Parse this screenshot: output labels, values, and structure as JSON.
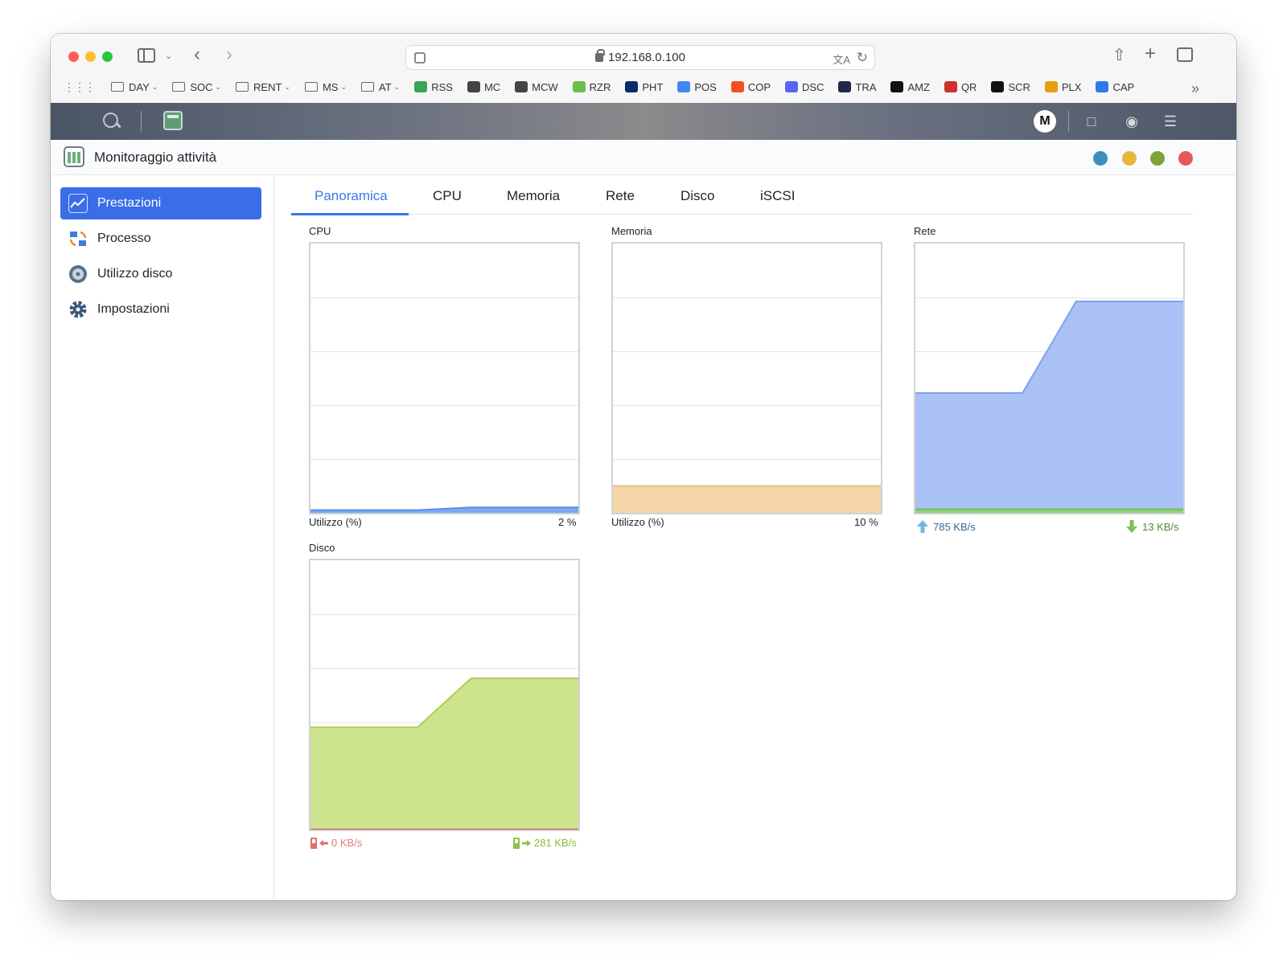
{
  "browser": {
    "url": "192.168.0.100",
    "bookmarks": [
      {
        "label": "DAY",
        "folder": true
      },
      {
        "label": "SOC",
        "folder": true
      },
      {
        "label": "RENT",
        "folder": true
      },
      {
        "label": "MS",
        "folder": true
      },
      {
        "label": "AT",
        "folder": true
      },
      {
        "label": "RSS",
        "color": "#3aa35a"
      },
      {
        "label": "MC",
        "color": "#444444"
      },
      {
        "label": "MCW",
        "color": "#444444"
      },
      {
        "label": "RZR",
        "color": "#6bbf4a"
      },
      {
        "label": "PHT",
        "color": "#0b2a6b"
      },
      {
        "label": "POS",
        "color": "#4285f4"
      },
      {
        "label": "COP",
        "color": "#f25022"
      },
      {
        "label": "DSC",
        "color": "#5865f2"
      },
      {
        "label": "TRA",
        "color": "#1f2a44"
      },
      {
        "label": "AMZ",
        "color": "#111111"
      },
      {
        "label": "QR",
        "color": "#d0312d"
      },
      {
        "label": "SCR",
        "color": "#111111"
      },
      {
        "label": "PLX",
        "color": "#e5a00d"
      },
      {
        "label": "CAP",
        "color": "#2f7bea"
      }
    ]
  },
  "dsm": {
    "avatar_letter": "M"
  },
  "app": {
    "title": "Monitoraggio attività"
  },
  "sidebar": {
    "items": [
      {
        "label": "Prestazioni",
        "active": true
      },
      {
        "label": "Processo",
        "active": false
      },
      {
        "label": "Utilizzo disco",
        "active": false
      },
      {
        "label": "Impostazioni",
        "active": false
      }
    ]
  },
  "tabs": [
    "Panoramica",
    "CPU",
    "Memoria",
    "Rete",
    "Disco",
    "iSCSI"
  ],
  "active_tab": "Panoramica",
  "panels": {
    "cpu": {
      "title": "CPU",
      "foot_label": "Utilizzo (%)",
      "foot_value": "2 %"
    },
    "memory": {
      "title": "Memoria",
      "foot_label": "Utilizzo (%)",
      "foot_value": "10 %"
    },
    "network": {
      "title": "Rete",
      "upload": "785 KB/s",
      "download": "13 KB/s"
    },
    "disk": {
      "title": "Disco",
      "read": "0 KB/s",
      "write": "281 KB/s"
    }
  },
  "chart_data": [
    {
      "type": "area",
      "title": "CPU",
      "x": [
        0,
        1,
        2,
        3,
        4,
        5
      ],
      "series": [
        {
          "values": [
            1,
            1,
            1,
            2,
            2,
            2
          ],
          "color": "#7fa8f0"
        }
      ],
      "ylim": [
        0,
        100
      ],
      "grid": true
    },
    {
      "type": "area",
      "title": "Memoria",
      "x": [
        0,
        1,
        2,
        3,
        4,
        5
      ],
      "series": [
        {
          "values": [
            10,
            10,
            10,
            10,
            10,
            10
          ],
          "color": "#f5d6a9"
        }
      ],
      "ylim": [
        0,
        100
      ],
      "grid": true
    },
    {
      "type": "area",
      "title": "Rete",
      "x": [
        0,
        1,
        2,
        3,
        4,
        5
      ],
      "series": [
        {
          "values": [
            445,
            445,
            445,
            785,
            785,
            785
          ],
          "color": "#a9c1f5"
        },
        {
          "values": [
            13,
            13,
            13,
            13,
            13,
            13
          ],
          "color": "#8fd17d"
        }
      ],
      "ylim": [
        0,
        1000
      ],
      "grid": true
    },
    {
      "type": "area",
      "title": "Disco",
      "x": [
        0,
        1,
        2,
        3,
        4,
        5
      ],
      "series": [
        {
          "values": [
            190,
            190,
            190,
            281,
            281,
            281
          ],
          "color": "#cde38e"
        },
        {
          "values": [
            0,
            0,
            0,
            0,
            0,
            0
          ],
          "color": "#e07070"
        }
      ],
      "ylim": [
        0,
        500
      ],
      "grid": true
    }
  ]
}
